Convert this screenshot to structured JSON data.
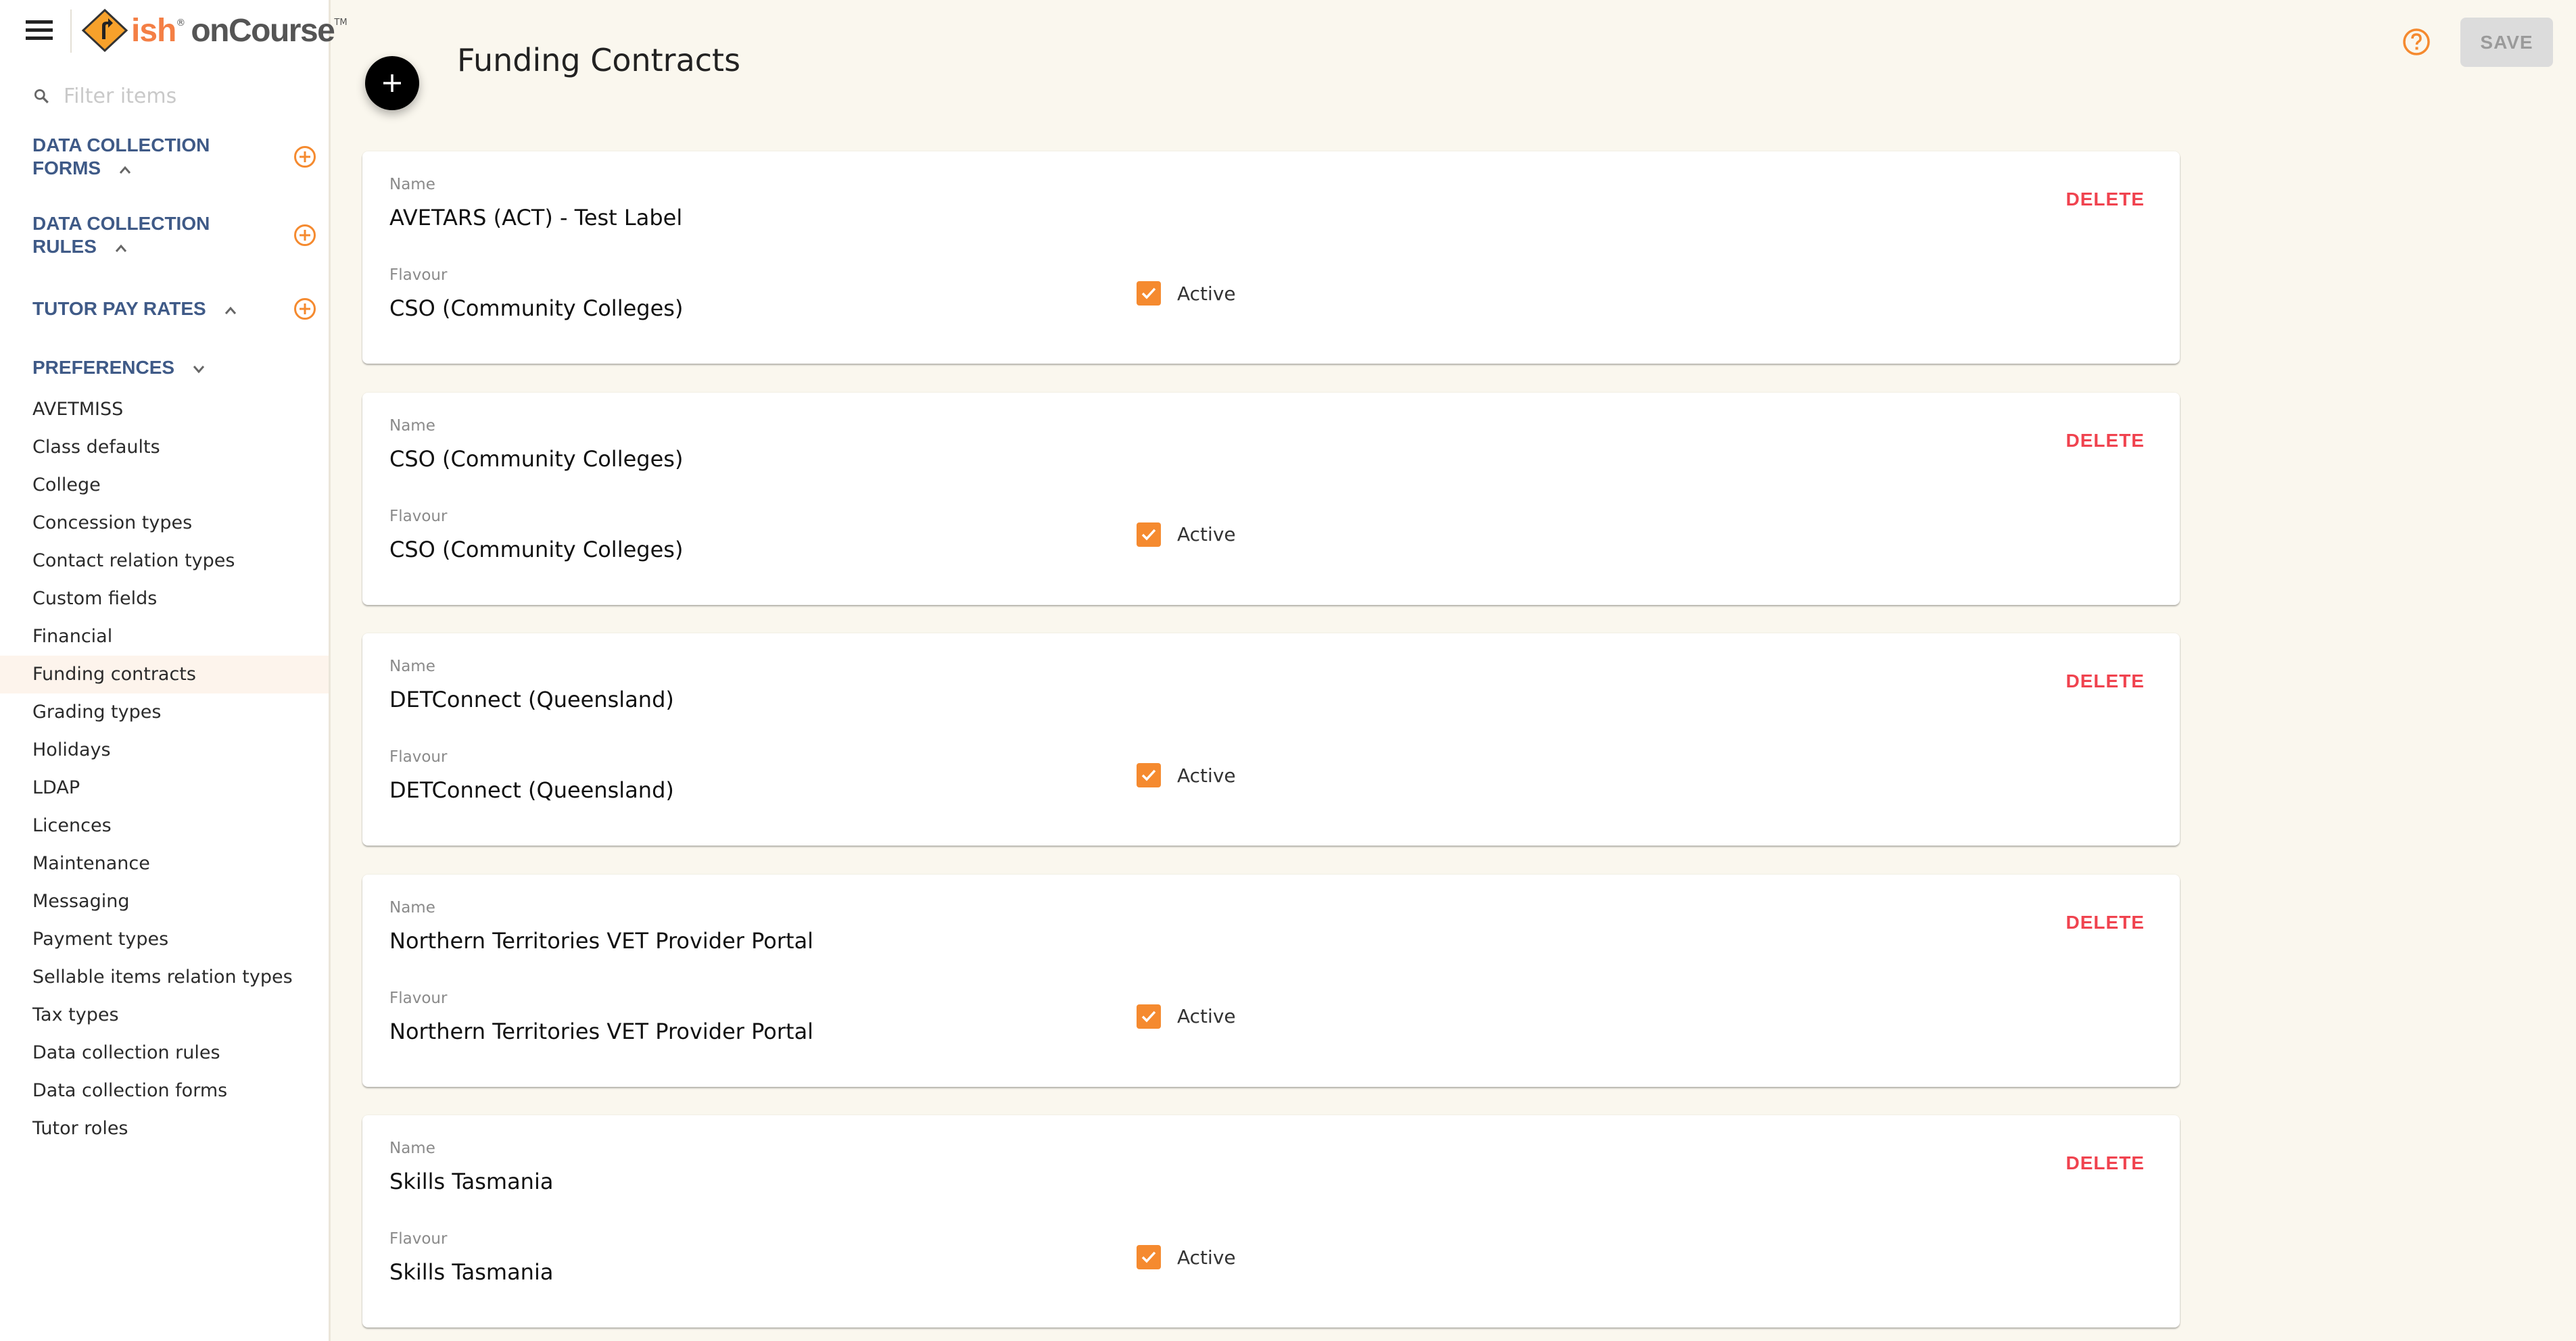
{
  "app": {
    "logo_left": "ish",
    "logo_reg": "®",
    "logo_right": "onCourse",
    "logo_tm": "TM"
  },
  "sidebar": {
    "filter_placeholder": "Filter items",
    "sections": [
      {
        "label": "DATA COLLECTION FORMS",
        "expanded": true,
        "has_add": true
      },
      {
        "label": "DATA COLLECTION RULES",
        "expanded": true,
        "has_add": true
      },
      {
        "label": "TUTOR PAY RATES",
        "expanded": true,
        "has_add": true
      },
      {
        "label": "PREFERENCES",
        "expanded": false,
        "has_add": false
      }
    ],
    "items": [
      {
        "label": "AVETMISS"
      },
      {
        "label": "Class defaults"
      },
      {
        "label": "College"
      },
      {
        "label": "Concession types"
      },
      {
        "label": "Contact relation types"
      },
      {
        "label": "Custom fields"
      },
      {
        "label": "Financial"
      },
      {
        "label": "Funding contracts",
        "active": true
      },
      {
        "label": "Grading types"
      },
      {
        "label": "Holidays"
      },
      {
        "label": "LDAP"
      },
      {
        "label": "Licences"
      },
      {
        "label": "Maintenance"
      },
      {
        "label": "Messaging"
      },
      {
        "label": "Payment types"
      },
      {
        "label": "Sellable items relation types"
      },
      {
        "label": "Tax types"
      },
      {
        "label": "Data collection rules"
      },
      {
        "label": "Data collection forms"
      },
      {
        "label": "Tutor roles"
      }
    ]
  },
  "header": {
    "title": "Funding Contracts",
    "save_label": "SAVE",
    "save_enabled": false
  },
  "field_labels": {
    "name": "Name",
    "flavour": "Flavour",
    "active": "Active",
    "delete": "DELETE"
  },
  "contracts": [
    {
      "name": "AVETARS (ACT) - Test Label",
      "flavour": "CSO (Community Colleges)",
      "active": true
    },
    {
      "name": "CSO (Community Colleges)",
      "flavour": "CSO (Community Colleges)",
      "active": true
    },
    {
      "name": "DETConnect (Queensland)",
      "flavour": "DETConnect (Queensland)",
      "active": true
    },
    {
      "name": "Northern Territories VET Provider Portal",
      "flavour": "Northern Territories VET Provider Portal",
      "active": true
    },
    {
      "name": "Skills Tasmania",
      "flavour": "Skills Tasmania",
      "active": true
    }
  ],
  "colors": {
    "accent": "#f58a2f",
    "danger": "#f0434f",
    "section_heading": "#3f5a87",
    "background": "#faf7ee"
  }
}
